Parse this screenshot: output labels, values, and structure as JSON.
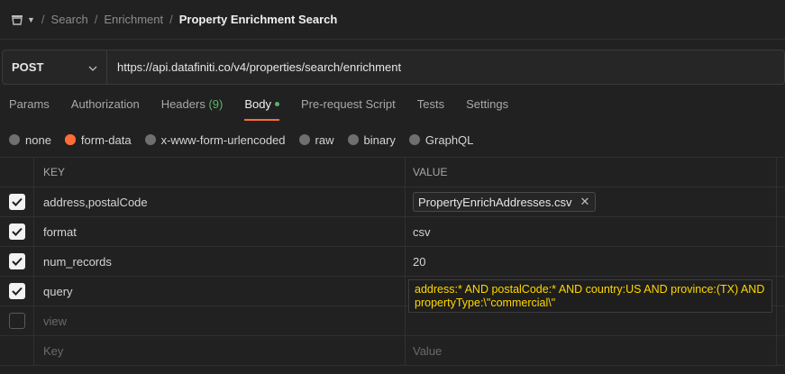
{
  "breadcrumb": {
    "items": [
      "Search",
      "Enrichment"
    ],
    "current": "Property Enrichment Search",
    "separator": "/"
  },
  "request": {
    "method": "POST",
    "url": "https://api.datafiniti.co/v4/properties/search/enrichment"
  },
  "tabs": {
    "params": "Params",
    "authorization": "Authorization",
    "headers": "Headers",
    "headers_count": "(9)",
    "body": "Body",
    "prerequest": "Pre-request Script",
    "tests": "Tests",
    "settings": "Settings"
  },
  "body_types": {
    "none": "none",
    "form_data": "form-data",
    "urlencoded": "x-www-form-urlencoded",
    "raw": "raw",
    "binary": "binary",
    "graphql": "GraphQL",
    "selected": "form-data"
  },
  "table": {
    "header_key": "KEY",
    "header_value": "VALUE",
    "rows": [
      {
        "key": "address,postalCode",
        "value": "PropertyEnrichAddresses.csv",
        "checked": true,
        "type": "file"
      },
      {
        "key": "format",
        "value": "csv",
        "checked": true,
        "type": "text"
      },
      {
        "key": "num_records",
        "value": "20",
        "checked": true,
        "type": "text"
      },
      {
        "key": "query",
        "value": "address:* AND postalCode:* AND country:US AND province:(TX) AND propertyType:\\\"commercial\\\"",
        "checked": true,
        "type": "text"
      }
    ],
    "disabled_row_key": "view",
    "new_row_key_placeholder": "Key",
    "new_row_value_placeholder": "Value"
  },
  "colors": {
    "accent": "#ff6c37",
    "success": "#59b36b",
    "query_text": "#ffd700"
  }
}
